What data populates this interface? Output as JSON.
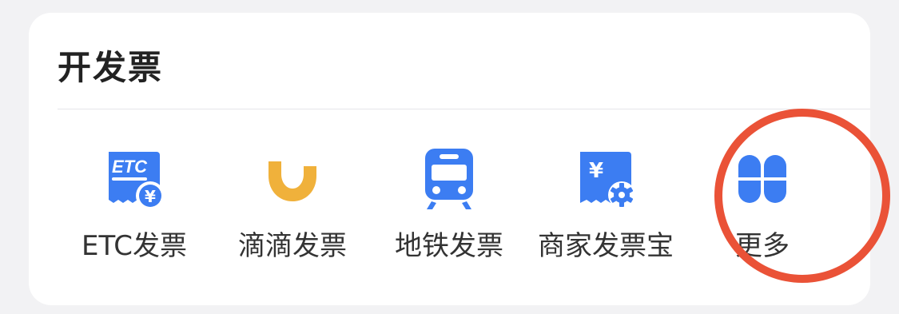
{
  "section": {
    "title": "开发票"
  },
  "items": [
    {
      "label": "ETC发票",
      "icon": "etc-invoice-icon",
      "icon_text": "ETC",
      "badge_text": "¥"
    },
    {
      "label": "滴滴发票",
      "icon": "didi-logo-icon"
    },
    {
      "label": "地铁发票",
      "icon": "subway-train-icon"
    },
    {
      "label": "商家发票宝",
      "icon": "merchant-invoice-icon",
      "icon_text": "¥"
    },
    {
      "label": "更多",
      "icon": "more-grid-icon"
    }
  ],
  "colors": {
    "brand_blue": "#3c7df2",
    "didi_orange": "#f0b13b",
    "highlight_red": "#ea5237",
    "text": "#333333",
    "title": "#222222"
  }
}
